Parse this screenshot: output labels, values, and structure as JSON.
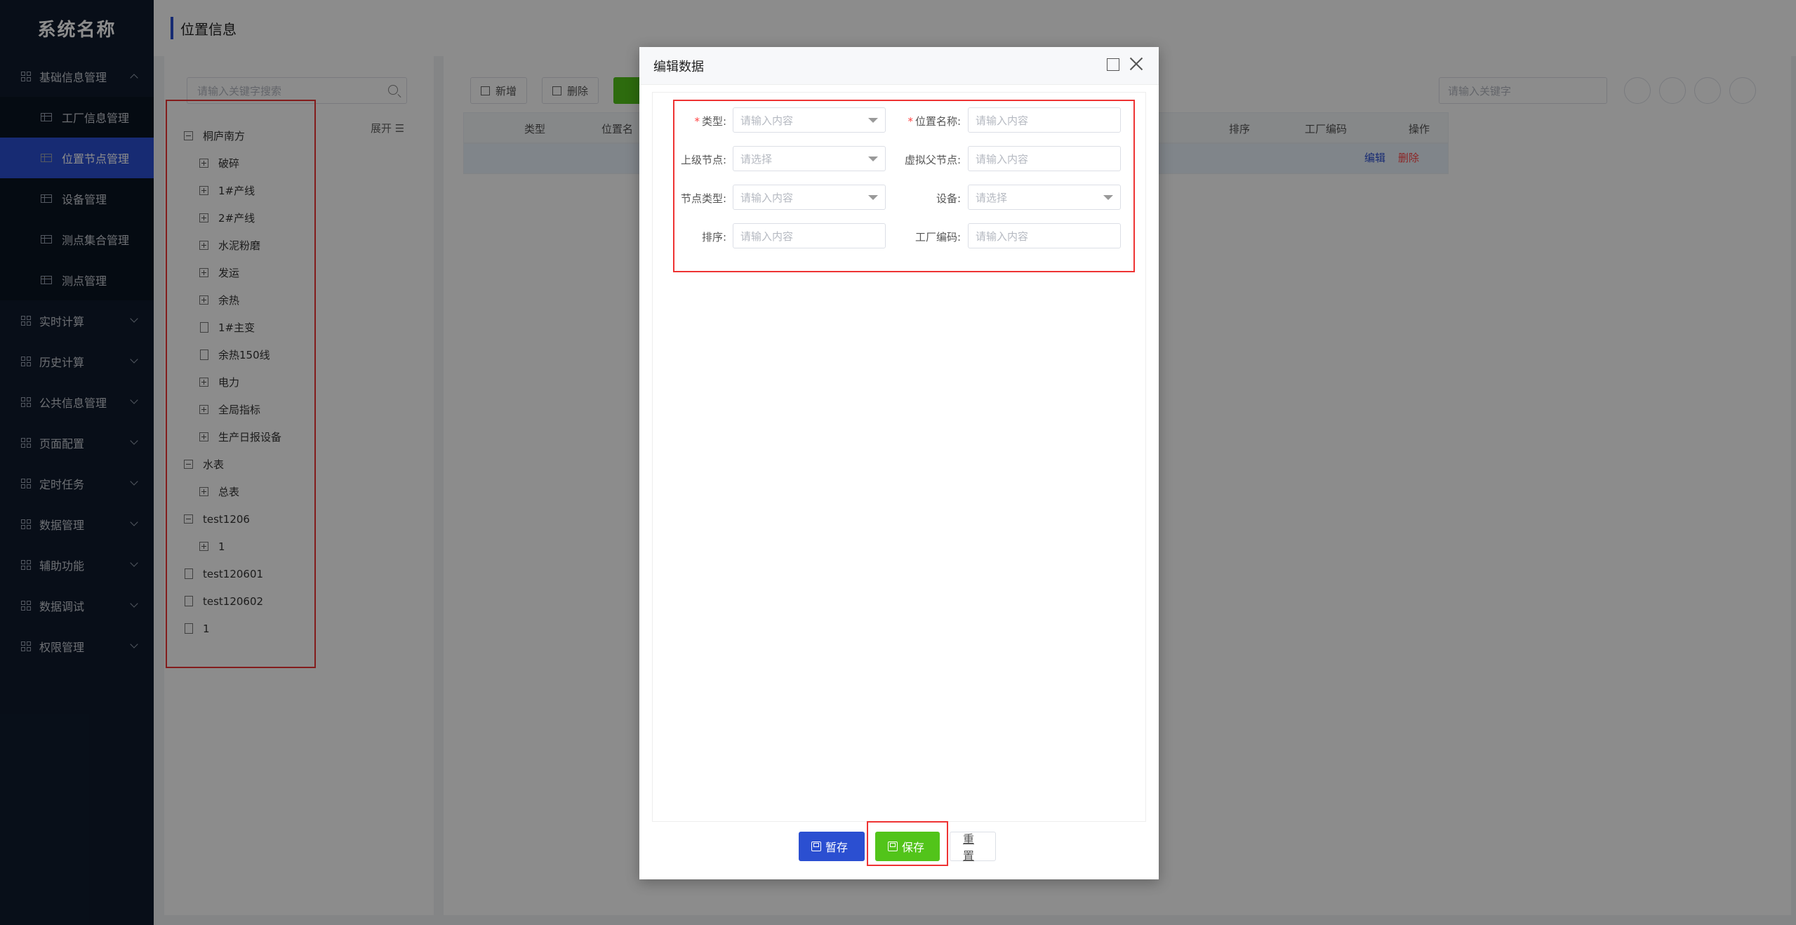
{
  "app": {
    "name": "系统名称"
  },
  "header": {
    "title": "位置信息"
  },
  "sidebar": {
    "groups": [
      {
        "label": "基础信息管理",
        "expanded": true
      },
      {
        "label": "实时计算"
      },
      {
        "label": "历史计算"
      },
      {
        "label": "公共信息管理"
      },
      {
        "label": "页面配置"
      },
      {
        "label": "定时任务"
      },
      {
        "label": "数据管理"
      },
      {
        "label": "辅助功能"
      },
      {
        "label": "数据调试"
      },
      {
        "label": "权限管理"
      }
    ],
    "subitems": [
      {
        "label": "工厂信息管理"
      },
      {
        "label": "位置节点管理",
        "active": true
      },
      {
        "label": "设备管理"
      },
      {
        "label": "测点集合管理"
      },
      {
        "label": "测点管理"
      }
    ]
  },
  "tree": {
    "search_placeholder": "请输入关键字搜索",
    "expand_label": "展开 ☰",
    "nodes": [
      {
        "label": "桐庐南方",
        "level": 0,
        "icon": "minus"
      },
      {
        "label": "破碎",
        "level": 1,
        "icon": "plus"
      },
      {
        "label": "1#产线",
        "level": 1,
        "icon": "plus"
      },
      {
        "label": "2#产线",
        "level": 1,
        "icon": "plus"
      },
      {
        "label": "水泥粉磨",
        "level": 1,
        "icon": "plus"
      },
      {
        "label": "发运",
        "level": 1,
        "icon": "plus"
      },
      {
        "label": "余热",
        "level": 1,
        "icon": "plus"
      },
      {
        "label": "1#主变",
        "level": 1,
        "icon": "file"
      },
      {
        "label": "余热150线",
        "level": 1,
        "icon": "file"
      },
      {
        "label": "电力",
        "level": 1,
        "icon": "plus"
      },
      {
        "label": "全局指标",
        "level": 1,
        "icon": "plus"
      },
      {
        "label": "生产日报设备",
        "level": 1,
        "icon": "plus"
      },
      {
        "label": "水表",
        "level": 0,
        "icon": "minus"
      },
      {
        "label": "总表",
        "level": 1,
        "icon": "plus"
      },
      {
        "label": "test1206",
        "level": 0,
        "icon": "minus"
      },
      {
        "label": "1",
        "level": 1,
        "icon": "plus"
      },
      {
        "label": "test120601",
        "level": 0,
        "icon": "file"
      },
      {
        "label": "test120602",
        "level": 0,
        "icon": "file"
      },
      {
        "label": "1",
        "level": 0,
        "icon": "file"
      }
    ]
  },
  "toolbar": {
    "add_label": "新增",
    "delete_label": "删除",
    "search_placeholder": "请输入关键字"
  },
  "table": {
    "columns": [
      "类型",
      "位置名",
      "排序",
      "工厂编码",
      "操作"
    ],
    "row_actions": {
      "edit": "编辑",
      "delete": "删除"
    }
  },
  "modal": {
    "title": "编辑数据",
    "fields": {
      "type": {
        "label": "类型:",
        "required": true,
        "placeholder": "请输入内容"
      },
      "name": {
        "label": "位置名称:",
        "required": true,
        "placeholder": "请输入内容"
      },
      "parent": {
        "label": "上级节点:",
        "placeholder": "请选择"
      },
      "virtual_parent": {
        "label": "虚拟父节点:",
        "placeholder": "请输入内容"
      },
      "node_type": {
        "label": "节点类型:",
        "placeholder": "请输入内容"
      },
      "device": {
        "label": "设备:",
        "placeholder": "请选择"
      },
      "sort": {
        "label": "排序:",
        "placeholder": "请输入内容"
      },
      "factory_code": {
        "label": "工厂编码:",
        "placeholder": "请输入内容"
      }
    },
    "buttons": {
      "draft": "暂存",
      "save": "保存",
      "reset": "重置"
    }
  },
  "colors": {
    "primary": "#2b4fd1",
    "success": "#52c41a",
    "sidebar": "#0f1b2d",
    "highlight": "#ee3333"
  }
}
